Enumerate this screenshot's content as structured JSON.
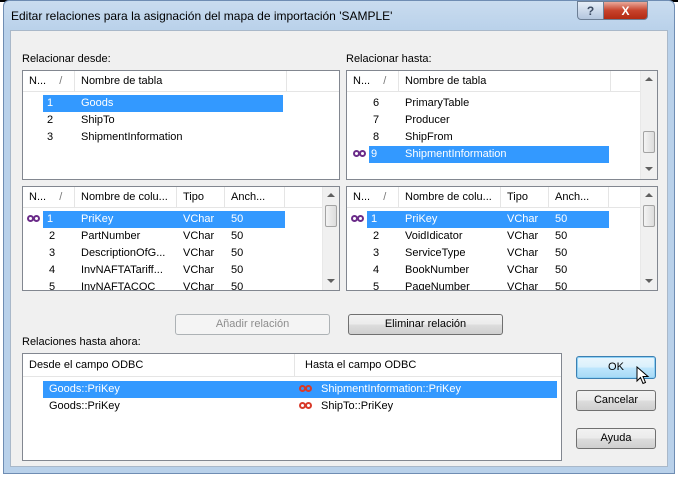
{
  "window": {
    "title": "Editar relaciones para la asignación del mapa de importación 'SAMPLE'",
    "help_button": "?",
    "close_button": "X"
  },
  "from_tables": {
    "label": "Relacionar desde:",
    "headers": [
      "N...",
      "/",
      "Nombre de tabla"
    ],
    "rows": [
      {
        "n": "1",
        "name": "Goods"
      },
      {
        "n": "2",
        "name": "ShipTo"
      },
      {
        "n": "3",
        "name": "ShipmentInformation"
      }
    ]
  },
  "to_tables": {
    "label": "Relacionar hasta:",
    "headers": [
      "N...",
      "/",
      "Nombre de tabla"
    ],
    "rows": [
      {
        "n": "6",
        "name": "PrimaryTable"
      },
      {
        "n": "7",
        "name": "Producer"
      },
      {
        "n": "8",
        "name": "ShipFrom"
      },
      {
        "n": "9",
        "name": "ShipmentInformation"
      }
    ]
  },
  "from_columns": {
    "headers": [
      "N...",
      "/",
      "Nombre de colu...",
      "Tipo",
      "Anch..."
    ],
    "rows": [
      {
        "n": "1",
        "name": "PriKey",
        "type": "VChar",
        "width": "50"
      },
      {
        "n": "2",
        "name": "PartNumber",
        "type": "VChar",
        "width": "50"
      },
      {
        "n": "3",
        "name": "DescriptionOfG...",
        "type": "VChar",
        "width": "50"
      },
      {
        "n": "4",
        "name": "InvNAFTATariff...",
        "type": "VChar",
        "width": "50"
      },
      {
        "n": "5",
        "name": "InvNAFTACOC",
        "type": "VChar",
        "width": "50"
      }
    ]
  },
  "to_columns": {
    "headers": [
      "N...",
      "/",
      "Nombre de colu...",
      "Tipo",
      "Anch..."
    ],
    "rows": [
      {
        "n": "1",
        "name": "PriKey",
        "type": "VChar",
        "width": "50"
      },
      {
        "n": "2",
        "name": "VoidIdicator",
        "type": "VChar",
        "width": "50"
      },
      {
        "n": "3",
        "name": "ServiceType",
        "type": "VChar",
        "width": "50"
      },
      {
        "n": "4",
        "name": "BookNumber",
        "type": "VChar",
        "width": "50"
      },
      {
        "n": "5",
        "name": "PageNumber",
        "type": "VChar",
        "width": "50"
      }
    ]
  },
  "actions": {
    "add_relation": "Añadir relación",
    "remove_relation": "Eliminar relación"
  },
  "relations": {
    "label": "Relaciones hasta ahora:",
    "headers": [
      "Desde el campo ODBC",
      "Hasta el campo ODBC"
    ],
    "rows": [
      {
        "from": "Goods::PriKey",
        "to": "ShipmentInformation::PriKey"
      },
      {
        "from": "Goods::PriKey",
        "to": "ShipTo::PriKey"
      }
    ]
  },
  "buttons": {
    "ok": "OK",
    "cancel": "Cancelar",
    "help": "Ayuda"
  },
  "colors": {
    "selection": "#3399ff",
    "link_icon_purple": "#6b2c89",
    "link_icon_red": "#d83a2a"
  }
}
